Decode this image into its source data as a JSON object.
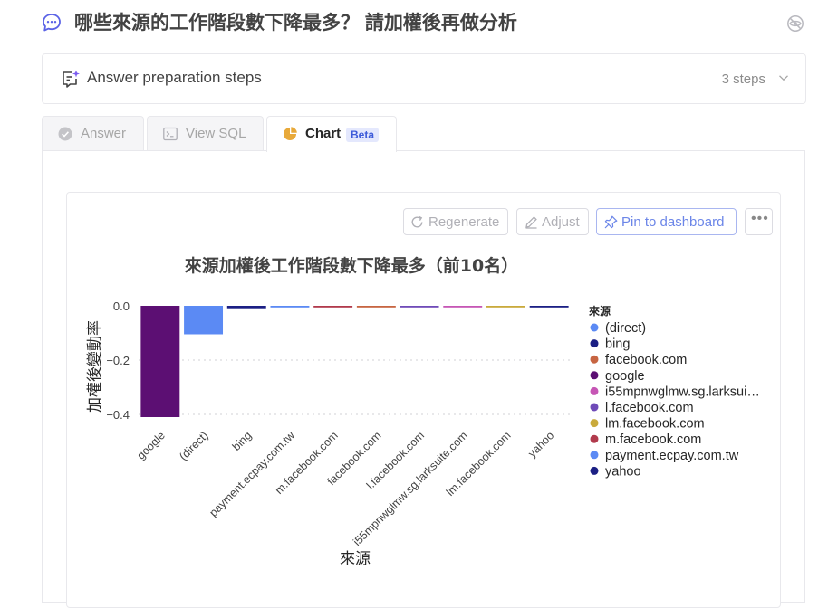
{
  "question": {
    "text": "哪些來源的工作階段數下降最多？ 請加權後再做分析",
    "icon": "chat-bubble-icon",
    "action_icon": "eye-off-icon"
  },
  "steps": {
    "title": "Answer preparation steps",
    "count_label": "3 steps",
    "icon": "sparkle-note-icon",
    "expand_icon": "chevron-down-icon"
  },
  "tabs": [
    {
      "label": "Answer",
      "icon": "check-circle-icon",
      "active": false
    },
    {
      "label": "View SQL",
      "icon": "terminal-icon",
      "active": false
    },
    {
      "label": "Chart",
      "icon": "pie-chart-icon",
      "active": true,
      "badge": "Beta"
    }
  ],
  "actions": {
    "regenerate": "Regenerate",
    "adjust": "Adjust",
    "pin": "Pin to dashboard",
    "more": "•••"
  },
  "colors": {
    "accent": "#3d5bd9",
    "chart_tab_icon": "#e8a93a"
  },
  "chart_data": {
    "type": "bar",
    "title": "來源加權後工作階段數下降最多（前10名）",
    "xlabel": "來源",
    "ylabel": "加權後變動率",
    "ylim": [
      -0.4,
      0.0
    ],
    "yticks": [
      0.0,
      -0.2,
      -0.4
    ],
    "ytick_labels": [
      "0.0",
      "−0.2",
      "−0.4"
    ],
    "grid": true,
    "categories": [
      "google",
      "(direct)",
      "bing",
      "payment.ecpay.com.tw",
      "m.facebook.com",
      "facebook.com",
      "l.facebook.com",
      "i55mpnwglmw.sg.larksuite.com",
      "lm.facebook.com",
      "yahoo"
    ],
    "values": [
      -0.41,
      -0.105,
      -0.009,
      -0.004,
      -0.004,
      -0.004,
      -0.003,
      -0.003,
      -0.003,
      -0.003
    ],
    "bar_colors": [
      "#5c0f73",
      "#5b8af4",
      "#1b1f84",
      "#5b8af4",
      "#b13a4c",
      "#c76542",
      "#6f4bb8",
      "#c656b5",
      "#c9aa3c",
      "#1b1f84"
    ],
    "legend": {
      "title": "來源",
      "placement": "right",
      "items": [
        {
          "name": "(direct)",
          "color": "#5b8af4"
        },
        {
          "name": "bing",
          "color": "#1b1f84"
        },
        {
          "name": "facebook.com",
          "color": "#c76542"
        },
        {
          "name": "google",
          "color": "#5c0f73"
        },
        {
          "name": "i55mpnwglmw.sg.larksui…",
          "color": "#c656b5"
        },
        {
          "name": "l.facebook.com",
          "color": "#6f4bb8"
        },
        {
          "name": "lm.facebook.com",
          "color": "#c9aa3c"
        },
        {
          "name": "m.facebook.com",
          "color": "#b13a4c"
        },
        {
          "name": "payment.ecpay.com.tw",
          "color": "#5b8af4"
        },
        {
          "name": "yahoo",
          "color": "#1b1f84"
        }
      ]
    }
  }
}
